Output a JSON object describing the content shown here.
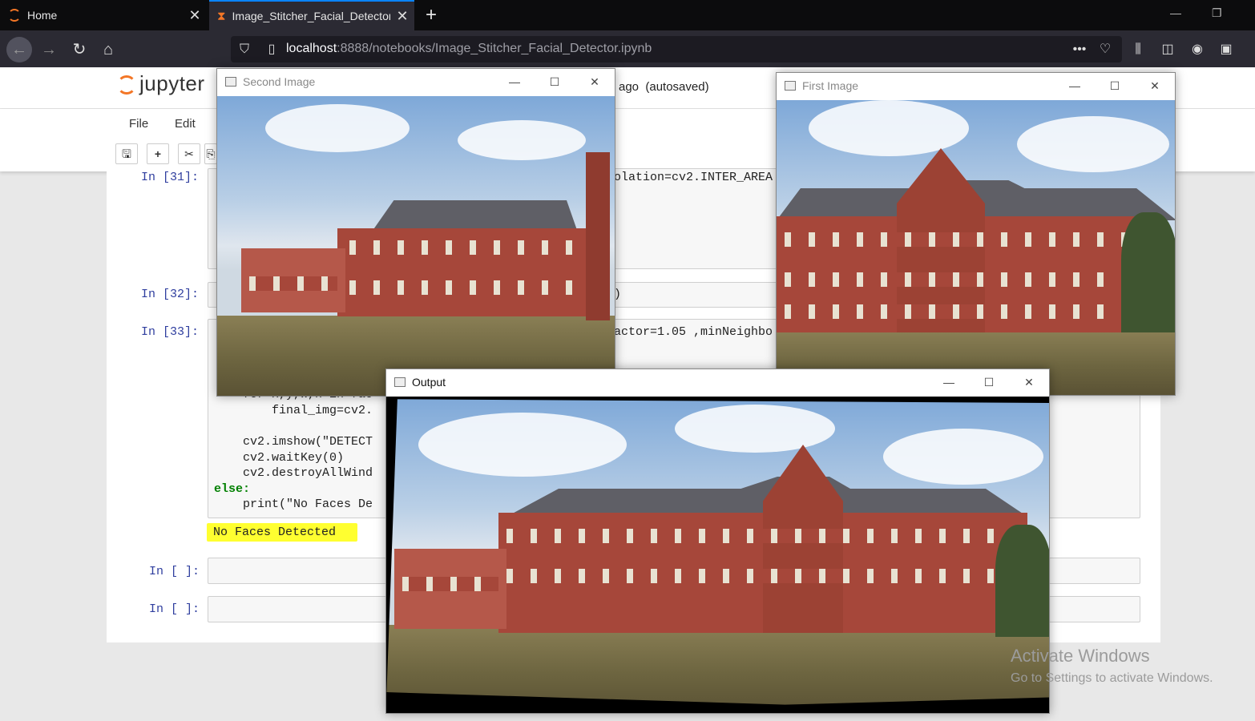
{
  "browser": {
    "tabs": [
      {
        "label": "Home"
      },
      {
        "label": "Image_Stitcher_Facial_Detector"
      }
    ],
    "url": {
      "host": "localhost",
      "path": ":8888/notebooks/Image_Stitcher_Facial_Detector.ipynb"
    }
  },
  "jupyter": {
    "logo_text": "jupyter",
    "status": "ago  (autosaved)",
    "menu": [
      "File",
      "Edit"
    ]
  },
  "cells": [
    {
      "prompt": "In [31]:",
      "visible_code": [
        "olation=cv2.INTER_AREA"
      ]
    },
    {
      "prompt": "In [32]:",
      "visible_code": [
        ")"
      ]
    },
    {
      "prompt": "In [33]:",
      "visible_code_right": "actor=1.05 ,minNeighbo",
      "lines": [
        "    for x,y,w,h in fac",
        "        final_img=cv2.",
        "",
        "    cv2.imshow(\"DETECT",
        "    cv2.waitKey(0)",
        "    cv2.destroyAllWind",
        "else:",
        "    print(\"No Faces De"
      ],
      "output": "No Faces Detected"
    },
    {
      "prompt": "In [ ]:"
    },
    {
      "prompt": "In [ ]:"
    }
  ],
  "windows": {
    "second": {
      "title": "Second Image"
    },
    "first": {
      "title": "First Image"
    },
    "output": {
      "title": "Output"
    }
  },
  "watermark": {
    "line1": "Activate Windows",
    "line2": "Go to Settings to activate Windows."
  }
}
